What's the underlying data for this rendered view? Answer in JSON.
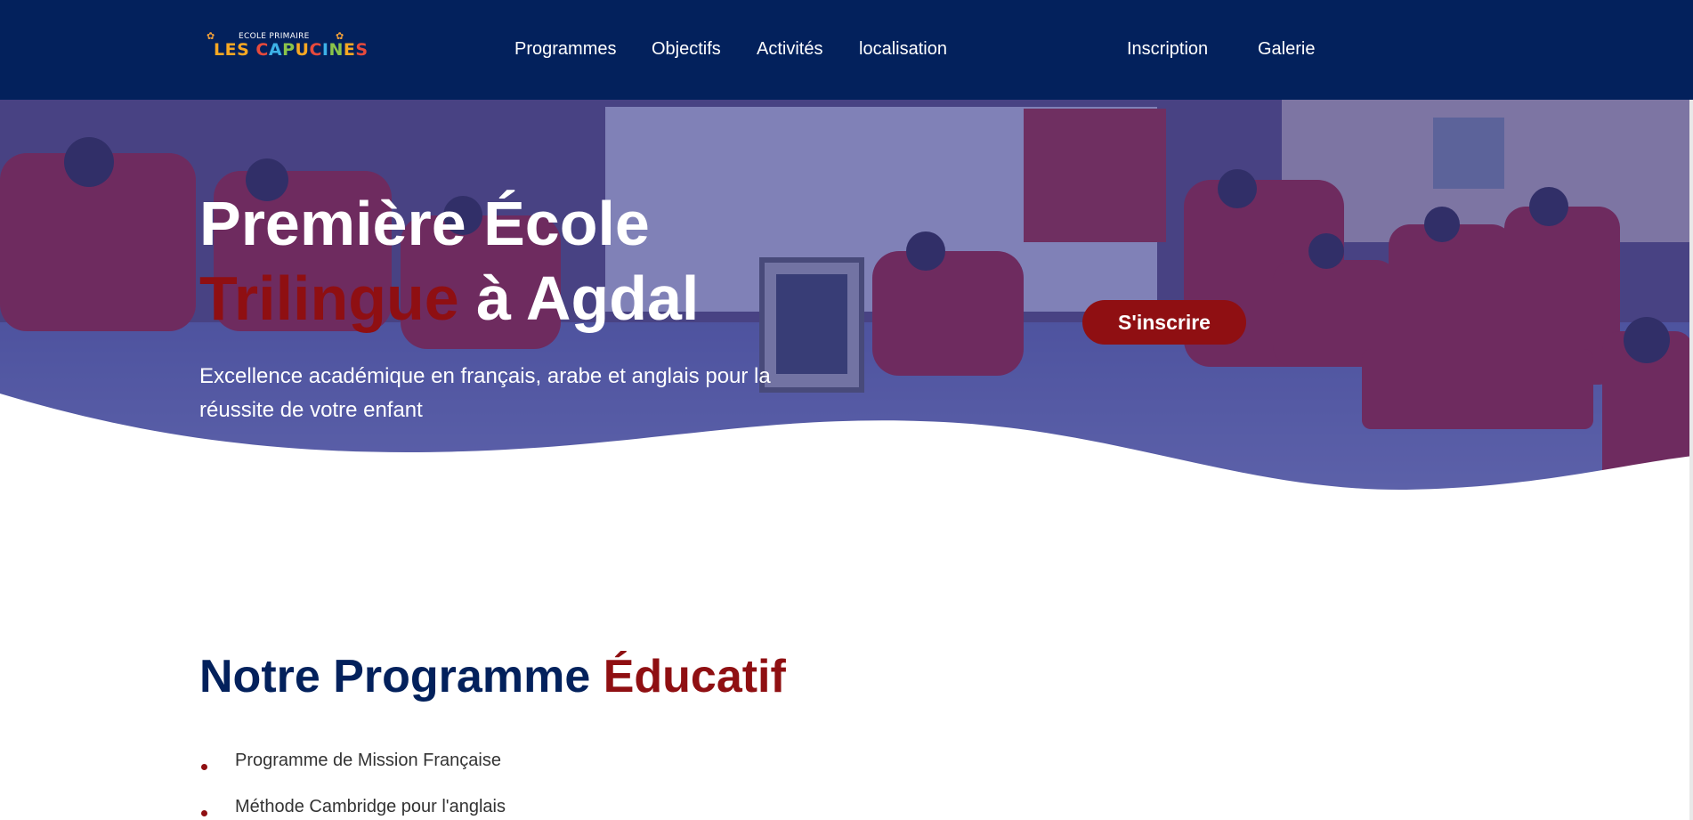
{
  "nav": {
    "logo": {
      "top_text": "ECOLE PRIMAIRE",
      "main_text": "LES CAPUCINES",
      "letters": [
        {
          "ch": "L",
          "color": "#f7a823"
        },
        {
          "ch": "E",
          "color": "#f7a823"
        },
        {
          "ch": "S",
          "color": "#f7a823"
        },
        {
          "ch": " ",
          "color": "#ffffff"
        },
        {
          "ch": "C",
          "color": "#e64a3c"
        },
        {
          "ch": "A",
          "color": "#3db2e8"
        },
        {
          "ch": "P",
          "color": "#8ac44a"
        },
        {
          "ch": "U",
          "color": "#f7a823"
        },
        {
          "ch": "C",
          "color": "#e64a3c"
        },
        {
          "ch": "I",
          "color": "#3db2e8"
        },
        {
          "ch": "N",
          "color": "#8ac44a"
        },
        {
          "ch": "E",
          "color": "#f7a823"
        },
        {
          "ch": "S",
          "color": "#e64a3c"
        }
      ]
    },
    "links": [
      {
        "label": "Programmes"
      },
      {
        "label": "Objectifs"
      },
      {
        "label": "Activités"
      },
      {
        "label": "localisation"
      },
      {
        "label": "Inscription"
      },
      {
        "label": "Galerie"
      }
    ]
  },
  "hero": {
    "title_line1": "Première École",
    "title_accent": "Trilingue",
    "title_rest": " à Agdal",
    "subtitle": "Excellence académique en français, arabe et anglais pour la réussite de votre enfant",
    "cta_label": "S'inscrire",
    "banner_text": "CAPUCINES",
    "banner_sub": "ECOLE PRIMAIRE"
  },
  "program": {
    "title": "Notre Programme ",
    "title_accent": "Éducatif",
    "items": [
      "Programme de Mission Française",
      "Méthode Cambridge pour l'anglais"
    ]
  },
  "colors": {
    "navy": "#03215c",
    "accent_red": "#8f0f12",
    "overlay": "#2a2f8a"
  }
}
